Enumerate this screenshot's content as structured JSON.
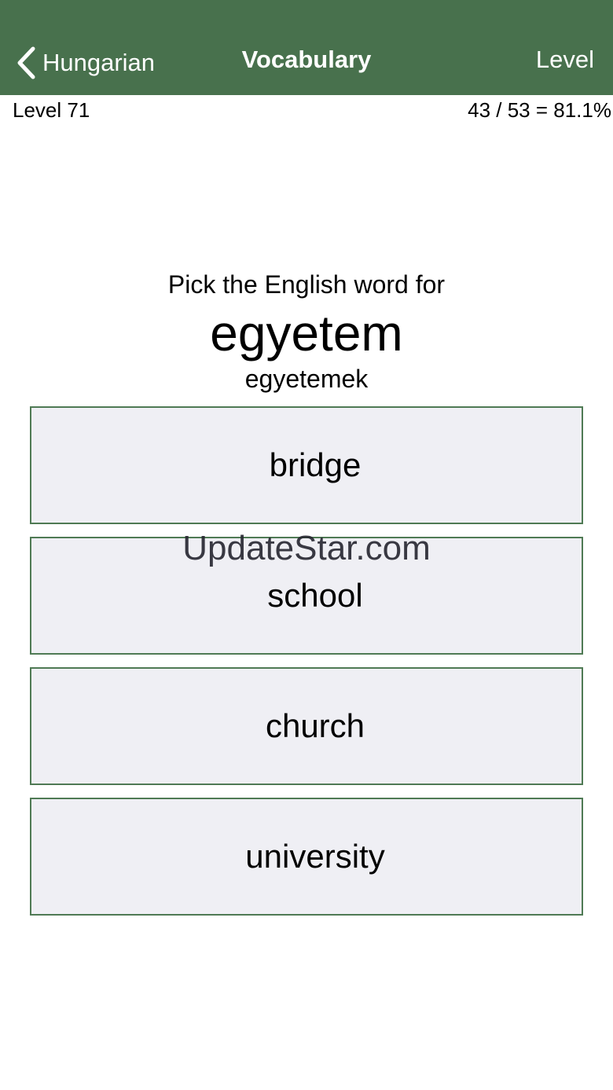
{
  "nav": {
    "back_label": "Hungarian",
    "title": "Vocabulary",
    "right_label": "Level",
    "bar_color": "#48714d"
  },
  "status": {
    "level": "Level 71",
    "score": "43 / 53 = 81.1%"
  },
  "question": {
    "prompt": "Pick the English word for",
    "word": "egyetem",
    "plural": "egyetemek"
  },
  "answers": [
    {
      "label": "bridge"
    },
    {
      "label": "school"
    },
    {
      "label": "church"
    },
    {
      "label": "university"
    }
  ],
  "watermark": "UpdateStar.com",
  "colors": {
    "accent": "#48714d",
    "answer_background": "#efeff4",
    "answer_border": "#4f7a54"
  }
}
